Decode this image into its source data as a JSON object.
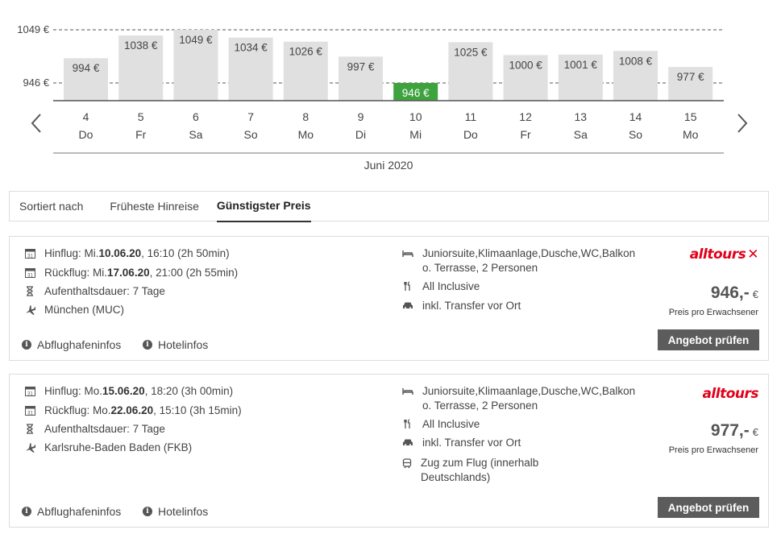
{
  "chart_data": {
    "type": "bar",
    "month_label": "Juni 2020",
    "days": [
      "4",
      "5",
      "6",
      "7",
      "8",
      "9",
      "10",
      "11",
      "12",
      "13",
      "14",
      "15"
    ],
    "weekdays": [
      "Do",
      "Fr",
      "Sa",
      "So",
      "Mo",
      "Di",
      "Mi",
      "Do",
      "Fr",
      "Sa",
      "So",
      "Mo"
    ],
    "values": [
      994,
      1038,
      1049,
      1034,
      1026,
      997,
      946,
      1025,
      1000,
      1001,
      1008,
      977
    ],
    "value_labels": [
      "994 €",
      "1038 €",
      "1049 €",
      "1034 €",
      "1026 €",
      "997 €",
      "946 €",
      "1025 €",
      "1000 €",
      "1001 €",
      "1008 €",
      "977 €"
    ],
    "reference_lines": [
      {
        "value": 1049,
        "label": "1049 €"
      },
      {
        "value": 946,
        "label": "946 €"
      }
    ],
    "highlight_index": 6,
    "colors": {
      "bar": "#e0e0e0",
      "highlight": "#3ea33e",
      "highlight_text": "#ffffff"
    }
  },
  "nav": {
    "prev_icon": "chevron-left-icon",
    "next_icon": "chevron-right-icon"
  },
  "sort": {
    "label": "Sortiert nach",
    "options": [
      "Früheste Hinreise",
      "Günstigster Preis"
    ],
    "active": "Günstigster Preis"
  },
  "offers": [
    {
      "outbound_prefix": "Hinflug: Mi. ",
      "outbound_date": "10.06.20",
      "outbound_rest": ", 16:10 (2h 50min)",
      "return_prefix": "Rückflug: Mi. ",
      "return_date": "17.06.20",
      "return_rest": ", 21:00 (2h 55min)",
      "stay": "Aufenthaltsdauer: 7 Tage",
      "airport": "München (MUC)",
      "room": "Juniorsuite,Klimaanlage,Dusche,WC,Balkon o. Terrasse, 2 Personen",
      "board": "All Inclusive",
      "transfer": "inkl. Transfer vor Ort",
      "operator": "alltours",
      "operator_mark": "✕",
      "price": "946,-",
      "currency": "€",
      "price_note": "Preis pro Erwachsener",
      "cta": "Angebot prüfen",
      "airport_info": "Abflughafeninfos",
      "hotel_info": "Hotelinfos"
    },
    {
      "outbound_prefix": "Hinflug: Mo. ",
      "outbound_date": "15.06.20",
      "outbound_rest": ", 18:20 (3h 00min)",
      "return_prefix": "Rückflug: Mo. ",
      "return_date": "22.06.20",
      "return_rest": ", 15:10 (3h 15min)",
      "stay": "Aufenthaltsdauer: 7 Tage",
      "airport": "Karlsruhe-Baden Baden (FKB)",
      "room": "Juniorsuite,Klimaanlage,Dusche,WC,Balkon o. Terrasse, 2 Personen",
      "board": "All Inclusive",
      "transfer": "inkl. Transfer vor Ort",
      "train": "Zug zum Flug (innerhalb Deutschlands)",
      "operator": "alltours",
      "price": "977,-",
      "currency": "€",
      "price_note": "Preis pro Erwachsener",
      "cta": "Angebot prüfen",
      "airport_info": "Abflughafeninfos",
      "hotel_info": "Hotelinfos"
    }
  ]
}
